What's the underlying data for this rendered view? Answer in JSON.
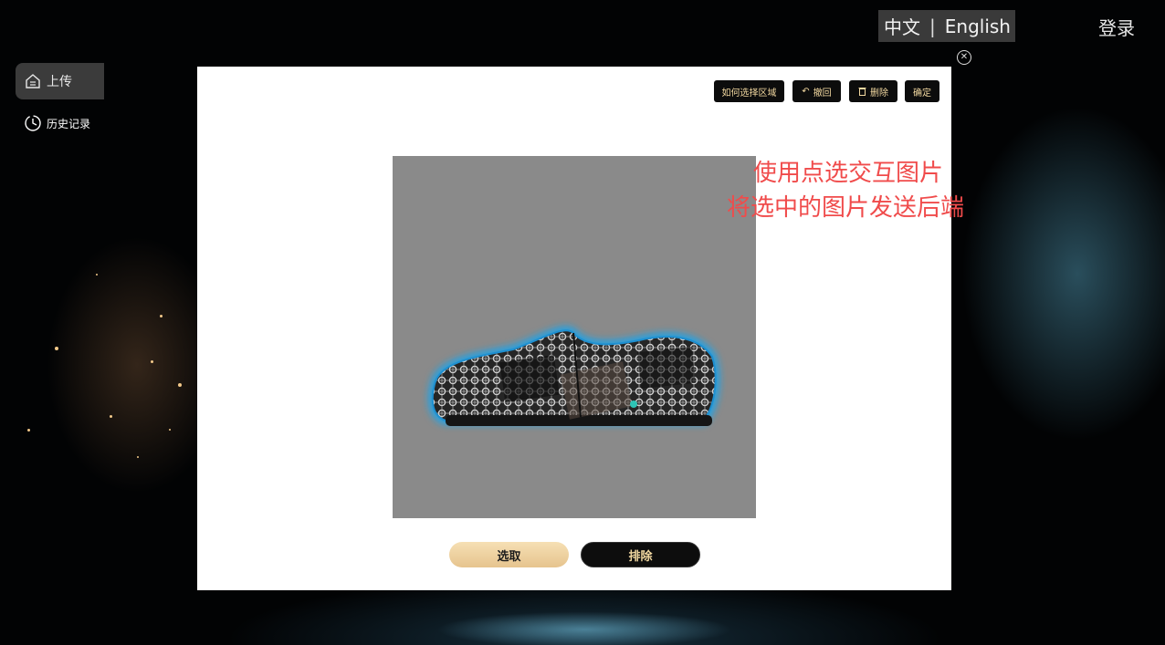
{
  "language": {
    "zh": "中文",
    "separator": "|",
    "en": "English"
  },
  "header": {
    "login": "登录"
  },
  "sidebar": {
    "items": [
      {
        "label": "上传",
        "icon": "home-icon"
      },
      {
        "label": "历史记录",
        "icon": "clock-icon"
      }
    ]
  },
  "modal": {
    "toolbar": {
      "howto": "如何选择区域",
      "undo": "撤回",
      "delete": "删除",
      "confirm": "确定"
    },
    "actions": {
      "select": "选取",
      "exclude": "排除"
    }
  },
  "annotation": {
    "line1": "使用点选交互图片",
    "line2": "将选中的图片发送后端"
  },
  "colors": {
    "accent_gold": "#f2d8a0",
    "annotation_red": "#f04b4b",
    "selection_glow": "#1fa3e8",
    "point_marker": "#2ec4b6"
  }
}
